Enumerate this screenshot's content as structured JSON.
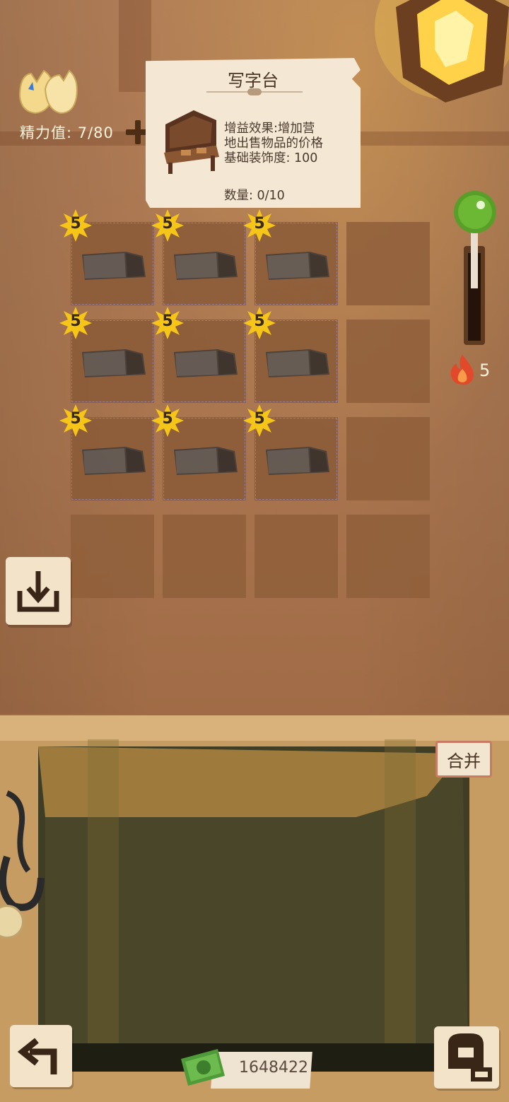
{
  "energy": {
    "label": "精力值: 7/80",
    "icon": "energy-flame-icon"
  },
  "item_card": {
    "title": "写字台",
    "description_lines": [
      "增益效果:增加营",
      "地出售物品的价格",
      "基础装饰度: 100"
    ],
    "count": "数量:  0/10"
  },
  "grid": {
    "rows": 4,
    "cols": 4,
    "items": [
      {
        "row": 0,
        "col": 0,
        "level": "5",
        "name": "stone"
      },
      {
        "row": 0,
        "col": 1,
        "level": "5",
        "name": "stone"
      },
      {
        "row": 0,
        "col": 2,
        "level": "5",
        "name": "stone"
      },
      {
        "row": 1,
        "col": 0,
        "level": "5",
        "name": "stone"
      },
      {
        "row": 1,
        "col": 1,
        "level": "5",
        "name": "stone"
      },
      {
        "row": 1,
        "col": 2,
        "level": "5",
        "name": "stone"
      },
      {
        "row": 2,
        "col": 0,
        "level": "5",
        "name": "stone"
      },
      {
        "row": 2,
        "col": 1,
        "level": "5",
        "name": "stone"
      },
      {
        "row": 2,
        "col": 2,
        "level": "5",
        "name": "stone"
      }
    ]
  },
  "furnace": {
    "count": "5"
  },
  "bag": {
    "merge_label": "合并"
  },
  "money": {
    "amount": "1648422"
  },
  "colors": {
    "badge": "#f5c518",
    "accent": "#c67b62",
    "lever_knob": "#5a9e2a"
  }
}
